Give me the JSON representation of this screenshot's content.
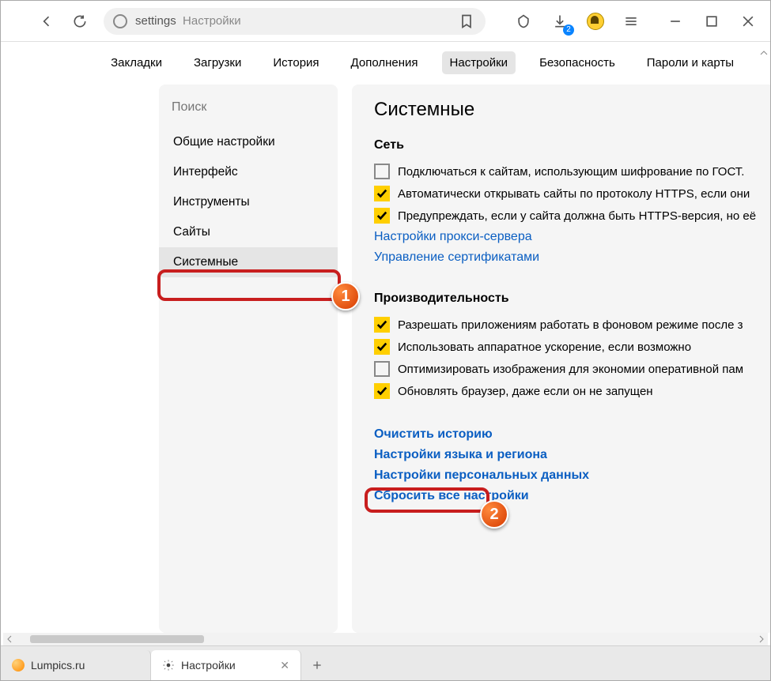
{
  "toolbar": {
    "address_prefix": "settings",
    "address_suffix": "Настройки",
    "download_badge": "2"
  },
  "toptabs": {
    "bookmarks": "Закладки",
    "downloads": "Загрузки",
    "history": "История",
    "addons": "Дополнения",
    "settings": "Настройки",
    "security": "Безопасность",
    "passwords": "Пароли и карты"
  },
  "sidebar": {
    "search_placeholder": "Поиск",
    "items": [
      "Общие настройки",
      "Интерфейс",
      "Инструменты",
      "Сайты",
      "Системные"
    ]
  },
  "content": {
    "heading": "Системные",
    "network": {
      "title": "Сеть",
      "opts": [
        {
          "checked": false,
          "label": "Подключаться к сайтам, использующим шифрование по ГОСТ."
        },
        {
          "checked": true,
          "label": "Автоматически открывать сайты по протоколу HTTPS, если они"
        },
        {
          "checked": true,
          "label": "Предупреждать, если у сайта должна быть HTTPS-версия, но её"
        }
      ],
      "links": [
        "Настройки прокси-сервера",
        "Управление сертификатами"
      ]
    },
    "performance": {
      "title": "Производительность",
      "opts": [
        {
          "checked": true,
          "label": "Разрешать приложениям работать в фоновом режиме после з"
        },
        {
          "checked": true,
          "label": "Использовать аппаратное ускорение, если возможно"
        },
        {
          "checked": false,
          "label": "Оптимизировать изображения для экономии оперативной пам"
        },
        {
          "checked": true,
          "label": "Обновлять браузер, даже если он не запущен"
        }
      ]
    },
    "bottom_links": [
      "Очистить историю",
      "Настройки языка и региона",
      "Настройки персональных данных",
      "Сбросить все настройки"
    ]
  },
  "annotations": {
    "badge1": "1",
    "badge2": "2"
  },
  "bottomtabs": {
    "tab1": "Lumpics.ru",
    "tab2": "Настройки"
  }
}
